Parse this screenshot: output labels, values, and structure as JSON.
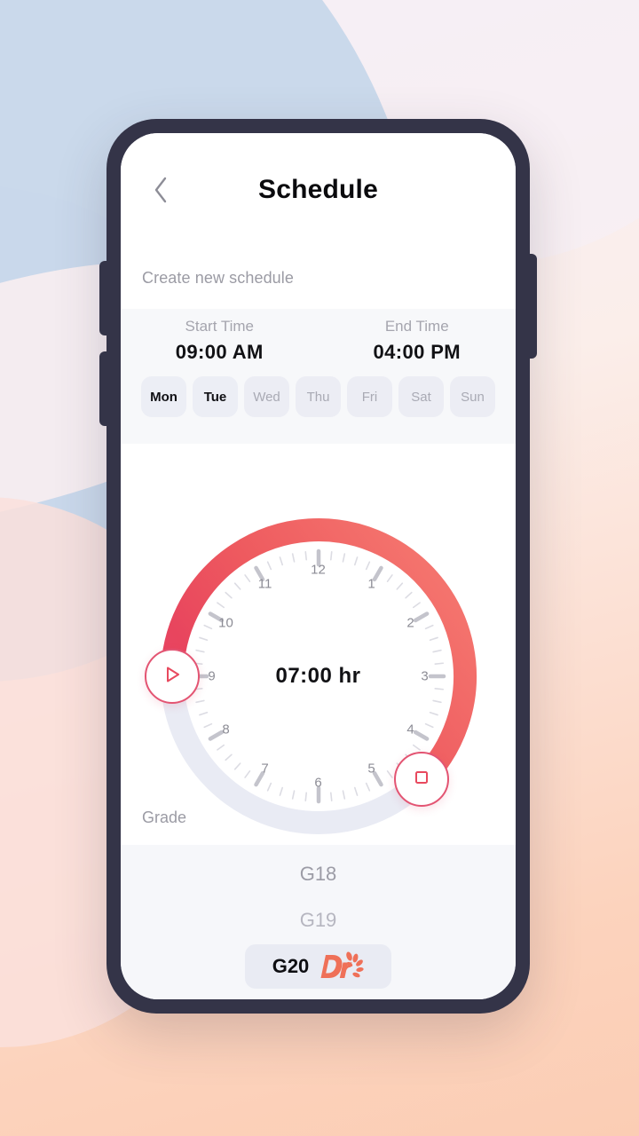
{
  "theme": {
    "accent": "#e8495e",
    "accent_light": "#f2716f",
    "track": "#e9ebf4",
    "frame": "#343448",
    "panel_bg": "#f7f8fa",
    "chip_bg": "#ecedf4",
    "muted_text": "#9b9ba4"
  },
  "header": {
    "title": "Schedule",
    "back_icon": "chevron-left-icon"
  },
  "subtitle": "Create new schedule",
  "time": {
    "start": {
      "label": "Start Time",
      "value": "09:00 AM"
    },
    "end": {
      "label": "End Time",
      "value": "04:00 PM"
    }
  },
  "days": [
    {
      "label": "Mon",
      "selected": true
    },
    {
      "label": "Tue",
      "selected": true
    },
    {
      "label": "Wed",
      "selected": false
    },
    {
      "label": "Thu",
      "selected": false
    },
    {
      "label": "Fri",
      "selected": false
    },
    {
      "label": "Sat",
      "selected": false
    },
    {
      "label": "Sun",
      "selected": false
    }
  ],
  "clock": {
    "duration": "07:00 hr",
    "hours": [
      "12",
      "1",
      "2",
      "3",
      "4",
      "5",
      "6",
      "7",
      "8",
      "9",
      "10",
      "11"
    ],
    "start_handle_icon": "play-icon",
    "end_handle_icon": "stop-icon",
    "arc_start_hour": 9,
    "arc_end_hour": 4,
    "arc_start_deg": 270,
    "arc_end_deg": 135
  },
  "grade": {
    "label": "Grade",
    "options": [
      {
        "label": "G18",
        "selected": false
      },
      {
        "label": "G19",
        "selected": false
      },
      {
        "label": "G20",
        "selected": true
      }
    ],
    "brand_logo": "dr-flower-logo"
  }
}
